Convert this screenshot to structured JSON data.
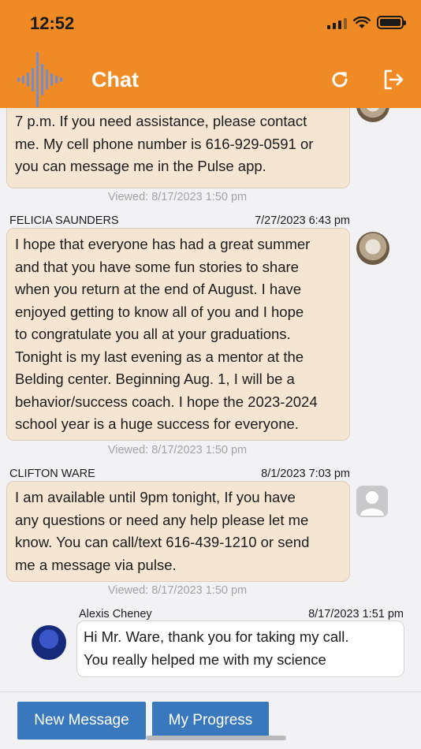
{
  "status_bar": {
    "time": "12:52"
  },
  "header": {
    "title": "Chat"
  },
  "messages": [
    {
      "lines": [
        "7 p.m. If you need assistance, please contact",
        "me. My cell phone number is 616-929-0591 or",
        "you can message me in the Pulse app."
      ],
      "viewed": "Viewed: 8/17/2023 1:50 pm"
    },
    {
      "sender": "FELICIA SAUNDERS",
      "time": "7/27/2023 6:43 pm",
      "lines": [
        "I hope that everyone has had a great summer",
        "and that you have some fun stories to share",
        "when you return at the end of August. I have",
        "enjoyed getting to know all of you and I hope",
        "to congratulate you all at your graduations.",
        "Tonight is my last evening as a mentor at the",
        "Belding center. Beginning Aug. 1, I will be a",
        "behavior/success coach. I hope the 2023-2024",
        "school year is a huge success for everyone."
      ],
      "viewed": "Viewed: 8/17/2023 1:50 pm"
    },
    {
      "sender": "CLIFTON WARE",
      "time": "8/1/2023 7:03 pm",
      "lines": [
        "I am available until 9pm tonight, If you have",
        "any questions or need any help please let me",
        "know. You can call/text 616-439-1210 or send",
        "me a message via pulse."
      ],
      "viewed": "Viewed: 8/17/2023 1:50 pm"
    }
  ],
  "reply": {
    "sender": "Alexis Cheney",
    "time": "8/17/2023 1:51 pm",
    "lines": [
      "Hi Mr. Ware, thank you for taking my call.",
      "You really helped me with my science"
    ]
  },
  "bottom": {
    "new_message": "New Message",
    "my_progress": "My Progress"
  },
  "colors": {
    "header": "#f08a24",
    "bubble": "#f5e5d3",
    "button": "#3a78bd",
    "logo": "#6d8fd8"
  },
  "icons": {
    "refresh": "refresh-icon",
    "logout": "logout-icon",
    "logo": "pulse-waveform-logo"
  }
}
